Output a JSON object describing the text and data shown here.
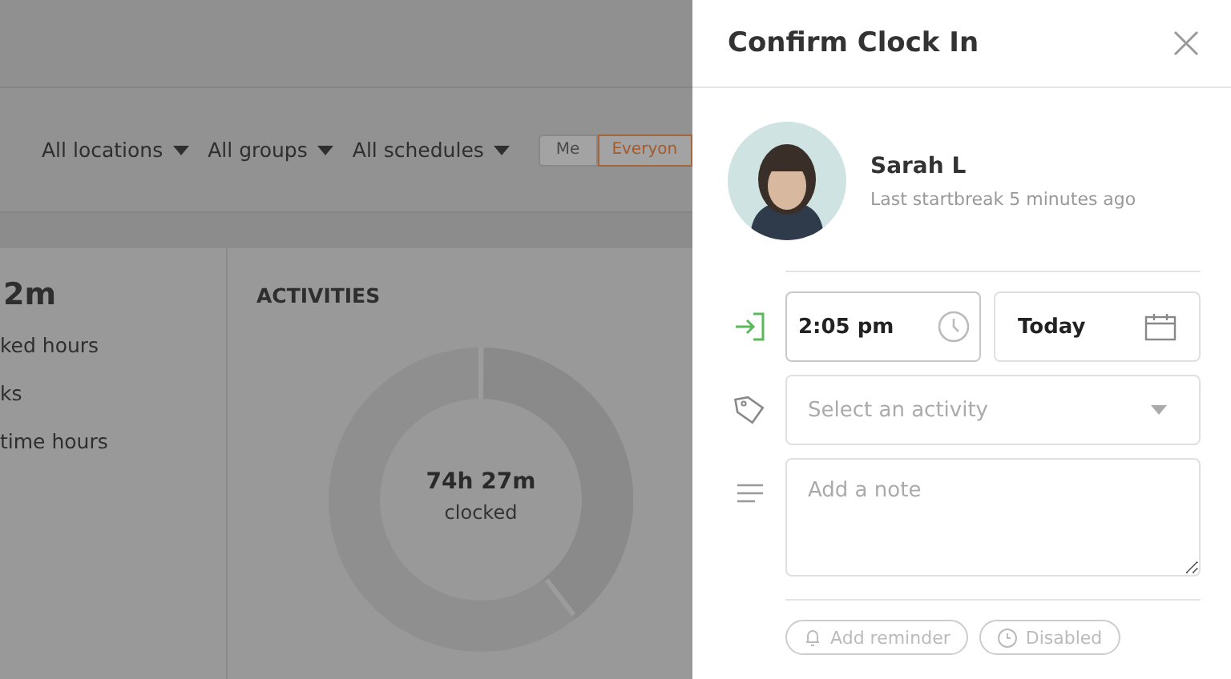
{
  "background": {
    "filters": [
      {
        "label": "All locations"
      },
      {
        "label": "All groups"
      },
      {
        "label": "All schedules"
      }
    ],
    "toggle": [
      {
        "label": "Me",
        "selected": false
      },
      {
        "label": "Everyon",
        "selected": true
      }
    ],
    "summary": {
      "value": "2m",
      "lines": [
        "ked hours",
        "ks",
        "time hours"
      ]
    },
    "activities": {
      "title": "ACTIVITIES",
      "total": "74h 27m",
      "caption": "clocked"
    }
  },
  "panel": {
    "title": "Confirm Clock In",
    "user": {
      "name": "Sarah L",
      "subtitle": "Last startbreak 5 minutes ago"
    },
    "time": {
      "value": "2:05 pm"
    },
    "date": {
      "value": "Today"
    },
    "activity": {
      "placeholder": "Select an activity"
    },
    "note": {
      "placeholder": "Add a note"
    },
    "pills": [
      {
        "label": "Add reminder",
        "kind": "reminder"
      },
      {
        "label": "Disabled",
        "kind": "status"
      }
    ]
  }
}
